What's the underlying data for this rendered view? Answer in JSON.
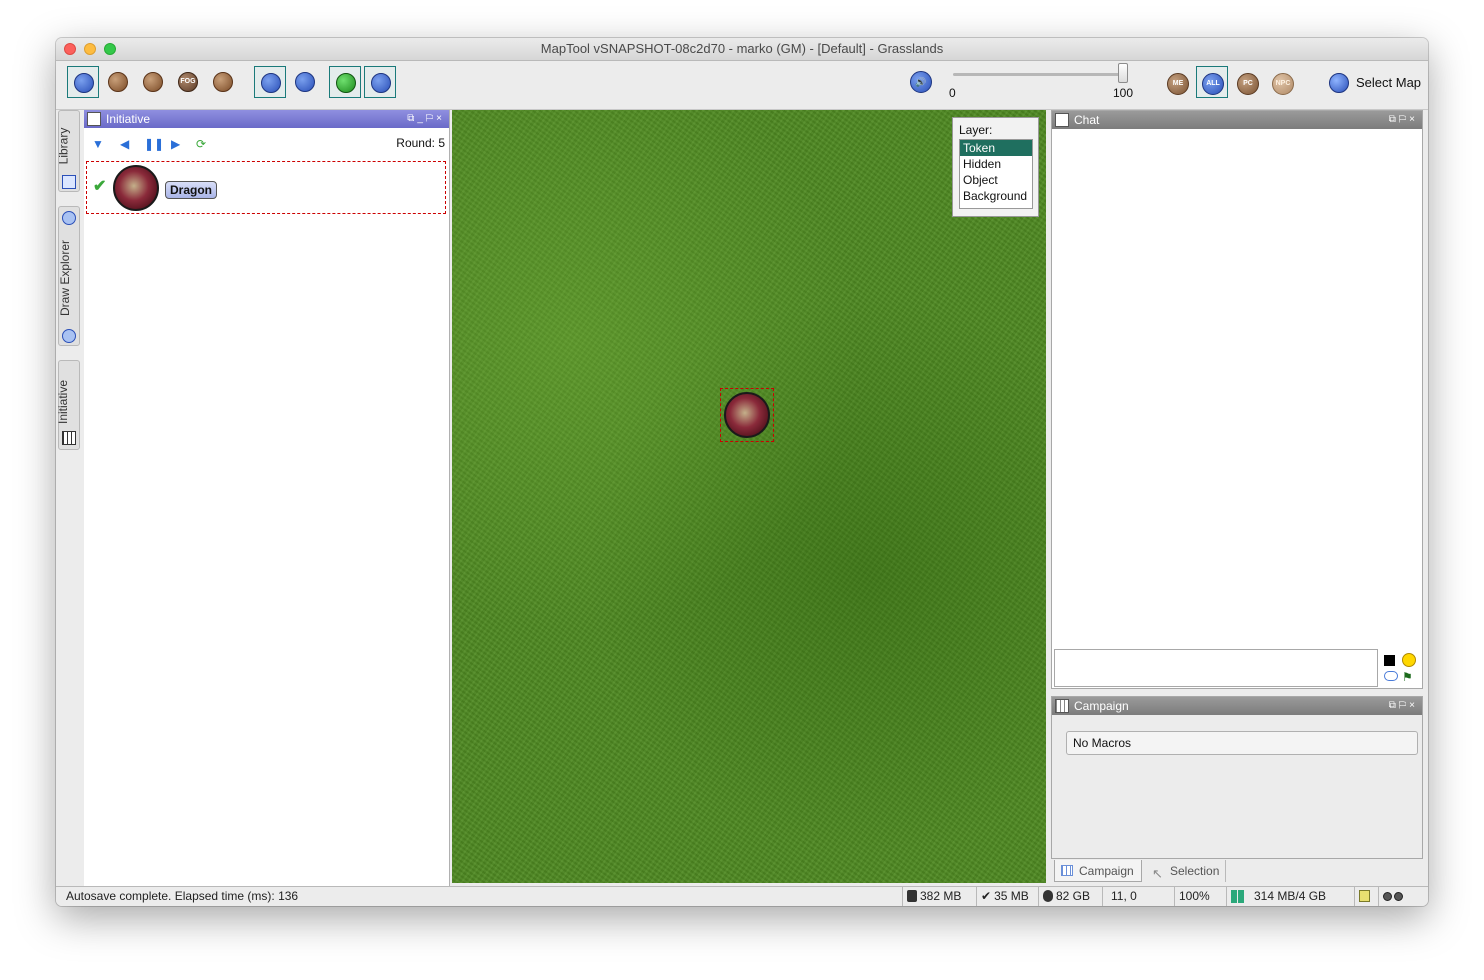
{
  "window": {
    "title": "MapTool vSNAPSHOT-08c2d70 - marko (GM) - [Default] - Grasslands"
  },
  "toolbar": {
    "tools": [
      {
        "name": "pointer-tool",
        "icon": "pointer-icon"
      },
      {
        "name": "draw-tool",
        "icon": "pencil-icon"
      },
      {
        "name": "template-tool",
        "icon": "template-icon"
      },
      {
        "name": "fog-tool",
        "icon": "fog-icon",
        "label": "FOG"
      },
      {
        "name": "vision-tool",
        "icon": "eye-icon"
      },
      {
        "name": "select-tool",
        "icon": "pointer-icon"
      },
      {
        "name": "measure-tool",
        "icon": "chart-icon"
      },
      {
        "name": "macro-tool",
        "icon": "token-icon"
      },
      {
        "name": "edit-tool",
        "icon": "check-icon"
      }
    ],
    "volume": {
      "min_label": "0",
      "max_label": "100",
      "value": 100
    },
    "player_views": [
      "ME",
      "ALL",
      "PC",
      "NPC"
    ],
    "selected_view": "ALL",
    "select_map_label": "Select Map"
  },
  "sidetabs": {
    "library": "Library",
    "draw_explorer": "Draw Explorer",
    "initiative": "Initiative"
  },
  "initiative": {
    "title": "Initiative",
    "round_label": "Round: 5",
    "entries": [
      {
        "name": "Dragon",
        "active": true
      }
    ]
  },
  "map": {
    "layer_label": "Layer:",
    "layers": [
      "Token",
      "Hidden",
      "Object",
      "Background"
    ],
    "selected_layer": "Token"
  },
  "chat": {
    "title": "Chat",
    "input_value": ""
  },
  "campaign": {
    "title": "Campaign",
    "no_macros": "No Macros",
    "tabs": [
      "Campaign",
      "Selection"
    ]
  },
  "status": {
    "message": "Autosave complete.  Elapsed time (ms): 136",
    "mem1": "382 MB",
    "mem2": "35 MB",
    "disk": "82 GB",
    "coords": "11, 0",
    "zoom": "100%",
    "heap": "314 MB/4 GB"
  }
}
